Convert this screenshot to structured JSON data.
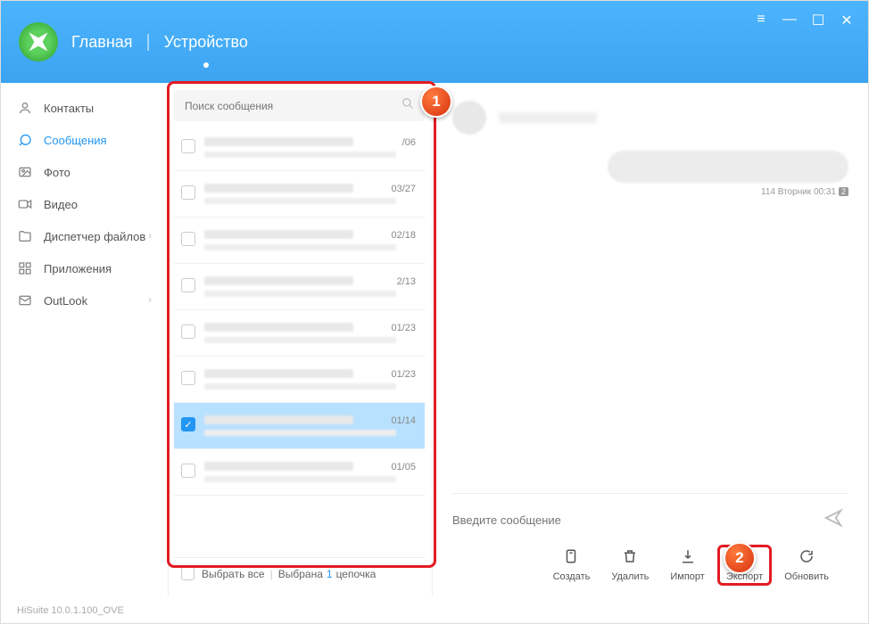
{
  "header": {
    "home": "Главная",
    "device": "Устройство"
  },
  "sidebar": {
    "items": [
      {
        "label": "Контакты"
      },
      {
        "label": "Сообщения"
      },
      {
        "label": "Фото"
      },
      {
        "label": "Видео"
      },
      {
        "label": "Диспетчер файлов"
      },
      {
        "label": "Приложения"
      },
      {
        "label": "OutLook"
      }
    ]
  },
  "search": {
    "placeholder": "Поиск сообщения"
  },
  "messages": [
    {
      "date": "/06"
    },
    {
      "date": "03/27"
    },
    {
      "date": "02/18"
    },
    {
      "date": "2/13"
    },
    {
      "date": "01/23"
    },
    {
      "date": "01/23"
    },
    {
      "date": "01/14"
    },
    {
      "date": "01/05"
    }
  ],
  "select_all": {
    "label": "Выбрать все",
    "selected_prefix": "Выбрана",
    "count": "1",
    "suffix": "цепочка"
  },
  "chat": {
    "meta": "114 Вторник 00:31",
    "badge": "2",
    "compose_placeholder": "Введите сообщение"
  },
  "toolbar": {
    "create": "Создать",
    "delete": "Удалить",
    "import": "Импорт",
    "export": "Экспорт",
    "refresh": "Обновить"
  },
  "status": "HiSuite 10.0.1.100_OVE",
  "callouts": {
    "one": "1",
    "two": "2"
  }
}
